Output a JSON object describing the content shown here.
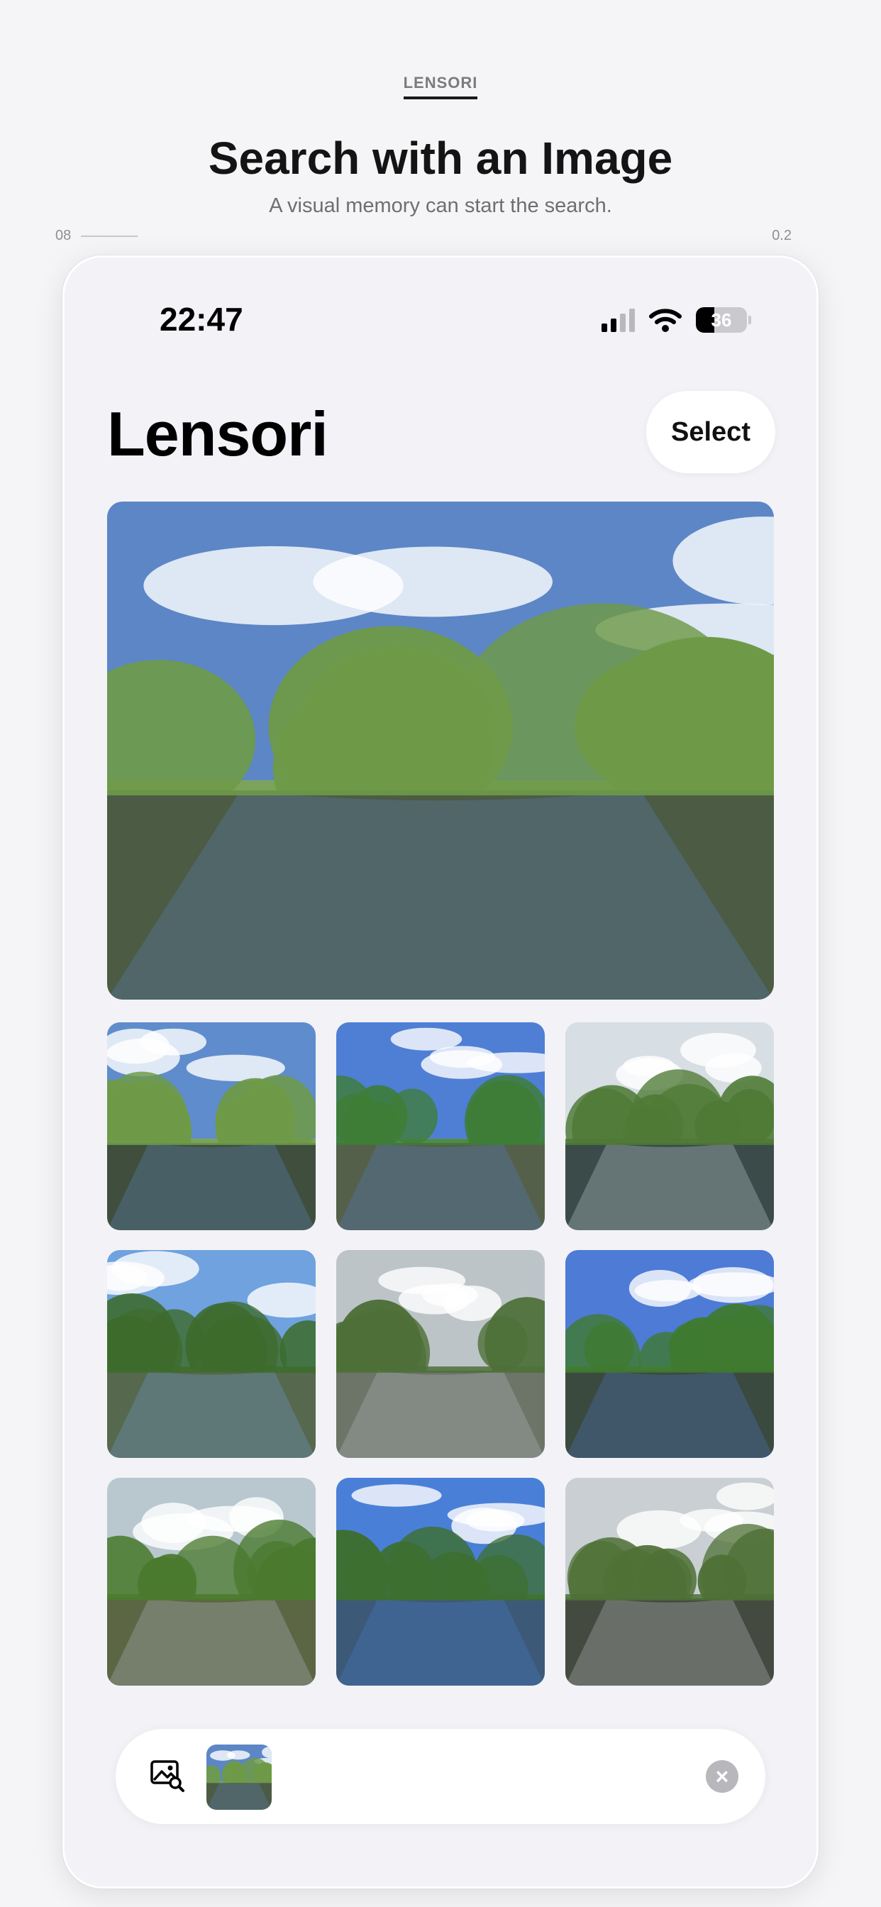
{
  "brand_tag": "LENSORI",
  "headline": "Search with an Image",
  "subhead": "A visual memory can start the search.",
  "meta_left": "08",
  "meta_right": "0.2",
  "status_bar": {
    "time": "22:47",
    "battery_percent": "36",
    "battery_level": 0.36,
    "signal_bars_active": 2,
    "signal_bars_total": 4,
    "icons": [
      "cellular-signal-icon",
      "wifi-icon",
      "battery-icon"
    ]
  },
  "app": {
    "title": "Lensori",
    "select_label": "Select"
  },
  "photos": {
    "hero": {
      "sky": "#5c86c6",
      "water": "#4b5b44",
      "foliage": "#6e9a48"
    },
    "thumbs": [
      {
        "sky": "#5f8ccc",
        "water": "#3f4e3d",
        "foliage": "#6e9a47"
      },
      {
        "sky": "#4f7fd4",
        "water": "#55604a",
        "foliage": "#3e7d36"
      },
      {
        "sky": "#d7dee4",
        "water": "#3a4b4a",
        "foliage": "#4f7a36"
      },
      {
        "sky": "#6fa2de",
        "water": "#56684e",
        "foliage": "#3d6b2c"
      },
      {
        "sky": "#bcc4c8",
        "water": "#6d7468",
        "foliage": "#4e7038"
      },
      {
        "sky": "#4d7bd6",
        "water": "#3b4a3f",
        "foliage": "#3f7a30"
      },
      {
        "sky": "#b9c7cf",
        "water": "#5c6544",
        "foliage": "#4a7a2e"
      },
      {
        "sky": "#4a7fd8",
        "water": "#3c5a78",
        "foliage": "#3d6f30"
      },
      {
        "sky": "#c9cfd2",
        "water": "#444a40",
        "foliage": "#4f7137"
      }
    ]
  },
  "search": {
    "icons": [
      "image-search-icon",
      "clear-icon"
    ]
  },
  "colors": {
    "background": "#f5f5f7",
    "phone_bg": "#f2f2f7",
    "accent_text": "#111111"
  }
}
